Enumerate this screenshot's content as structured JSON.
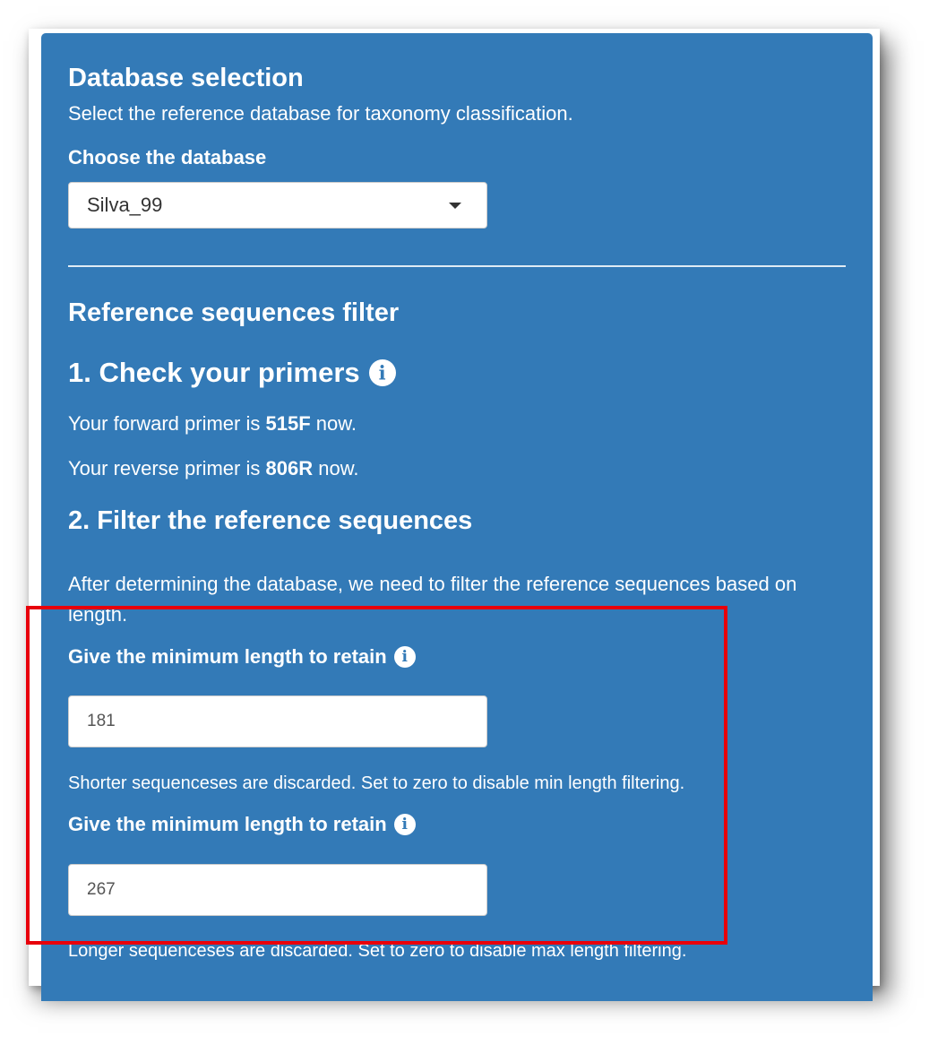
{
  "database_section": {
    "title": "Database selection",
    "description": "Select the reference database for taxonomy classification.",
    "select_label": "Choose the database",
    "selected_value": "Silva_99"
  },
  "filter_section": {
    "title": "Reference sequences filter",
    "primers_heading": "1. Check your primers",
    "forward_prefix": "Your forward primer is",
    "forward_primer": "515F",
    "forward_suffix": "now.",
    "reverse_prefix": "Your reverse primer is",
    "reverse_primer": "806R",
    "reverse_suffix": "now.",
    "filter_heading": "2. Filter the reference sequences",
    "filter_description": "After determining the database, we need to filter the reference sequences based on length.",
    "min_length": {
      "label": "Give the minimum length to retain",
      "value": "181",
      "help": "Shorter sequenceses are discarded. Set to zero to disable min length filtering."
    },
    "max_length": {
      "label": "Give the minimum length to retain",
      "value": "267",
      "help": "Longer sequenceses are discarded. Set to zero to disable max length filtering."
    }
  },
  "colors": {
    "panel_background": "#337ab7",
    "highlight_border": "#e8000b"
  },
  "icons": [
    "info-icon",
    "caret-down-icon"
  ]
}
